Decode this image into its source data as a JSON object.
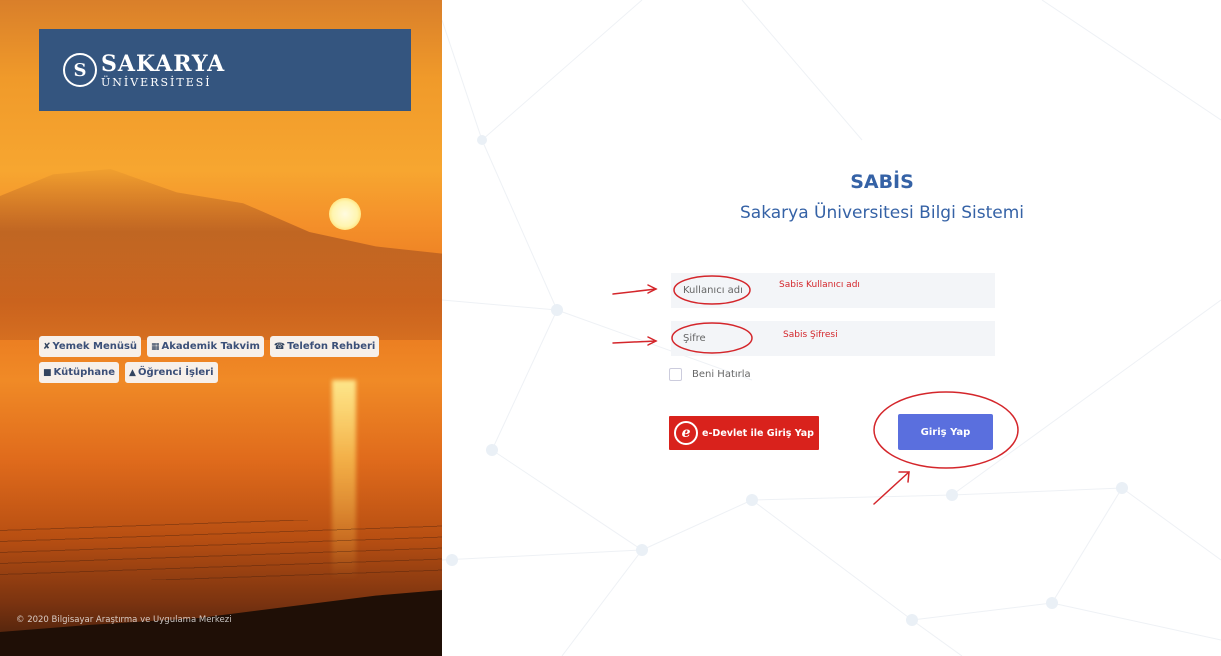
{
  "brand": {
    "logo_title": "SAKARYA",
    "logo_subtitle": "ÜNİVERSİTESİ",
    "logo_mark": "S",
    "color": "#34557f"
  },
  "quick_links": [
    {
      "label": "Yemek Menüsü",
      "icon": "fork-knife-icon"
    },
    {
      "label": "Akademik Takvim",
      "icon": "calendar-icon"
    },
    {
      "label": "Telefon Rehberi",
      "icon": "phone-icon"
    },
    {
      "label": "Kütüphane",
      "icon": "book-icon"
    },
    {
      "label": "Öğrenci İşleri",
      "icon": "student-icon"
    }
  ],
  "copyright": "© 2020 Bilgisayar Araştırma ve Uygulama Merkezi",
  "login": {
    "title": "SABİS",
    "subtitle": "Sakarya Üniversitesi Bilgi Sistemi",
    "username_placeholder": "Kullanıcı adı",
    "password_placeholder": "Şifre",
    "remember_label": "Beni Hatırla",
    "edevlet_label": "e-Devlet ile Giriş Yap",
    "login_label": "Giriş Yap",
    "accent_color": "#5a6fde",
    "title_color": "#3562a6",
    "edevlet_color": "#d9221c"
  },
  "annotations": {
    "username_note": "Sabis Kullanıcı adı",
    "password_note": "Sabis Şifresi",
    "color": "#d4262b"
  }
}
